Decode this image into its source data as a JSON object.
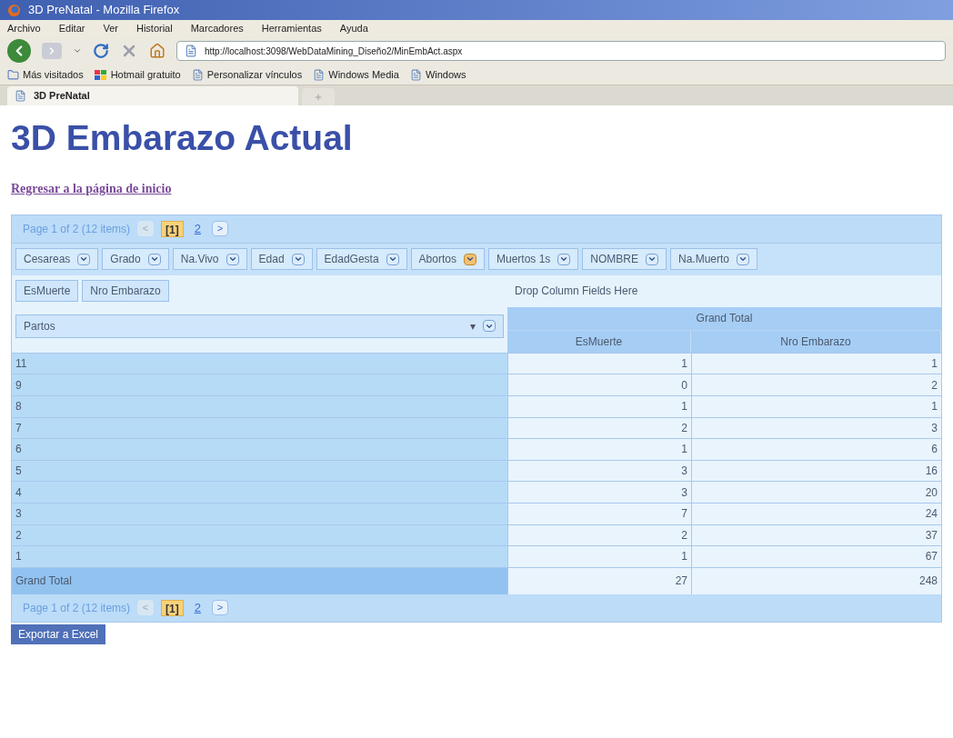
{
  "window": {
    "title": "3D PreNatal - Mozilla Firefox"
  },
  "menu": [
    "Archivo",
    "Editar",
    "Ver",
    "Historial",
    "Marcadores",
    "Herramientas",
    "Ayuda"
  ],
  "address_bar": {
    "value": "http://localhost:3098/WebDataMining_Diseño2/MinEmbAct.aspx"
  },
  "bookmarks": [
    {
      "label": "Más visitados",
      "kind": "folder"
    },
    {
      "label": "Hotmail gratuito",
      "kind": "windows"
    },
    {
      "label": "Personalizar vínculos",
      "kind": "page"
    },
    {
      "label": "Windows Media",
      "kind": "page"
    },
    {
      "label": "Windows",
      "kind": "page"
    }
  ],
  "tabs": [
    {
      "label": "3D PreNatal",
      "selected": true
    }
  ],
  "page": {
    "heading": "3D Embarazo Actual",
    "home_link": "Regresar a la página de inicio"
  },
  "pivot": {
    "pager_top": {
      "summary": "Page 1 of 2 (12 items)",
      "prev": "<",
      "next": ">",
      "pages": [
        {
          "label": "[1]",
          "selected": true
        },
        {
          "label": "2",
          "selected": false
        }
      ]
    },
    "filter_fields": [
      {
        "label": "Cesareas",
        "filtered": false
      },
      {
        "label": "Grado",
        "filtered": false
      },
      {
        "label": "Na.Vivo",
        "filtered": false
      },
      {
        "label": "Edad",
        "filtered": false
      },
      {
        "label": "EdadGesta",
        "filtered": false
      },
      {
        "label": "Abortos",
        "filtered": true
      },
      {
        "label": "Muertos 1s",
        "filtered": false
      },
      {
        "label": "NOMBRE",
        "filtered": false
      },
      {
        "label": "Na.Muerto",
        "filtered": false
      }
    ],
    "data_fields": [
      "EsMuerte",
      "Nro Embarazo"
    ],
    "column_drop_hint": "Drop Column Fields Here",
    "row_field": {
      "label": "Partos",
      "sort": "▾"
    },
    "column_header": "Grand Total",
    "columns": [
      "EsMuerte",
      "Nro Embarazo"
    ],
    "rows": [
      {
        "label": "11",
        "values": [
          "1",
          "1"
        ]
      },
      {
        "label": "9",
        "values": [
          "0",
          "2"
        ]
      },
      {
        "label": "8",
        "values": [
          "1",
          "1"
        ]
      },
      {
        "label": "7",
        "values": [
          "2",
          "3"
        ]
      },
      {
        "label": "6",
        "values": [
          "1",
          "6"
        ]
      },
      {
        "label": "5",
        "values": [
          "3",
          "16"
        ]
      },
      {
        "label": "4",
        "values": [
          "3",
          "20"
        ]
      },
      {
        "label": "3",
        "values": [
          "7",
          "24"
        ]
      },
      {
        "label": "2",
        "values": [
          "2",
          "37"
        ]
      },
      {
        "label": "1",
        "values": [
          "1",
          "67"
        ]
      }
    ],
    "total": {
      "label": "Grand Total",
      "values": [
        "27",
        "248"
      ]
    },
    "pager_bottom": {
      "summary": "Page 1 of 2 (12 items)",
      "prev": "<",
      "next": ">",
      "pages": [
        {
          "label": "[1]",
          "selected": true
        },
        {
          "label": "2",
          "selected": false
        }
      ]
    }
  },
  "export_button": "Exportar a Excel"
}
